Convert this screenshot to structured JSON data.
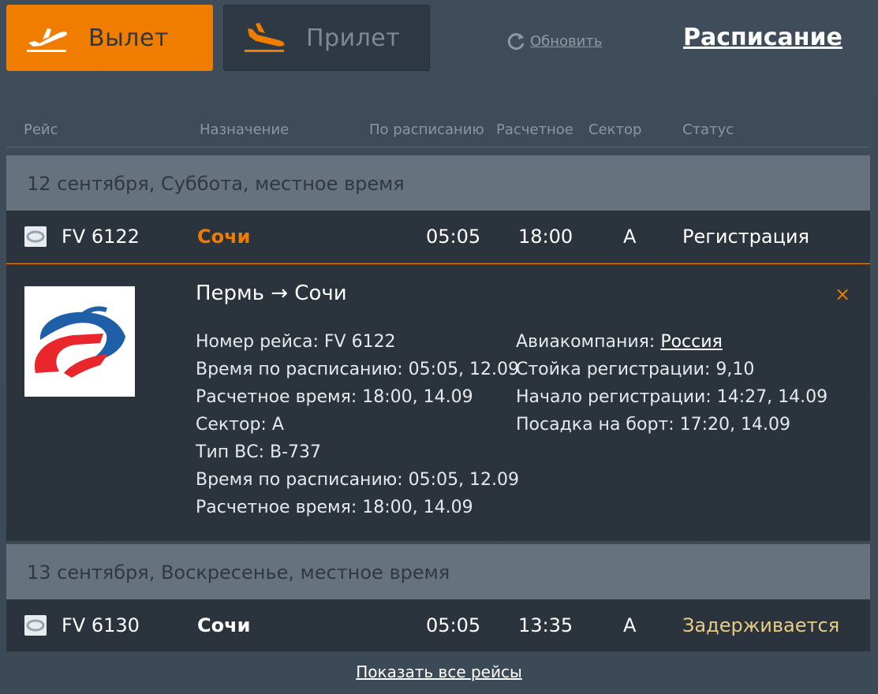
{
  "tabs": {
    "departure_label": "Вылет",
    "arrival_label": "Прилет"
  },
  "refresh_label": "Обновить",
  "schedule_label": "Расписание",
  "columns": {
    "flight": "Рейс",
    "destination": "Назначение",
    "scheduled": "По расписанию",
    "estimated": "Расчетное",
    "sector": "Сектор",
    "status": "Статус"
  },
  "groups": [
    {
      "date_label": "12 сентября, Суббота, местное время",
      "flight": {
        "number": "FV 6122",
        "destination": "Сочи",
        "scheduled": "05:05",
        "estimated": "18:00",
        "sector": "A",
        "status": "Регистрация"
      }
    },
    {
      "date_label": "13 сентября, Воскресенье, местное время",
      "flight": {
        "number": "FV 6130",
        "destination": "Сочи",
        "scheduled": "05:05",
        "estimated": "13:35",
        "sector": "A",
        "status": "Задерживается"
      }
    }
  ],
  "detail": {
    "route": "Пермь → Сочи",
    "left_lines": [
      "Номер рейса: FV 6122",
      "Время по расписанию: 05:05, 12.09",
      "Расчетное время: 18:00, 14.09",
      "Сектор: A",
      "Тип ВС: B-737",
      "Время по расписанию: 05:05, 12.09",
      "Расчетное время: 18:00, 14.09"
    ],
    "airline_prefix": "Авиакомпания: ",
    "airline_name": "Россия",
    "right_lines": [
      "Стойка регистрации: 9,10",
      "Начало регистрации: 14:27, 14.09",
      "Посадка на борт: 17:20, 14.09"
    ],
    "close_symbol": "×"
  },
  "show_all_label": "Показать все рейсы",
  "colors": {
    "accent": "#f07c00",
    "delayed": "#e6cc85",
    "band": "#66737e",
    "row": "#2b333c"
  },
  "icons": {
    "departure": "plane-takeoff-icon",
    "arrival": "plane-landing-icon",
    "refresh": "refresh-icon",
    "close": "close-icon"
  }
}
